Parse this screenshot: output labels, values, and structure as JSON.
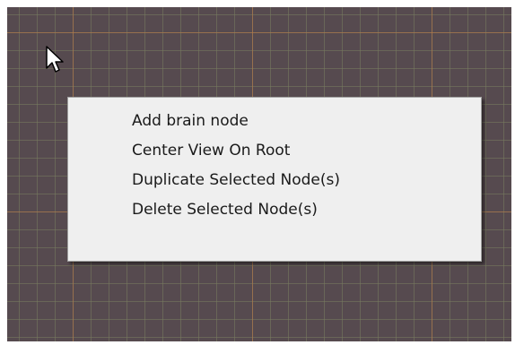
{
  "context_menu": {
    "items": [
      {
        "label": "Add brain node"
      },
      {
        "label": "Center View On Root"
      },
      {
        "label": "Duplicate Selected Node(s)"
      },
      {
        "label": "Delete Selected Node(s)"
      }
    ]
  },
  "icons": {
    "cursor": "arrow-pointer-icon"
  },
  "colors": {
    "canvas_background": "#564a4f",
    "major_grid": "#be7846",
    "minor_grid": "#787d5f",
    "menu_background": "#efefef",
    "menu_text": "#1a1a1a"
  }
}
